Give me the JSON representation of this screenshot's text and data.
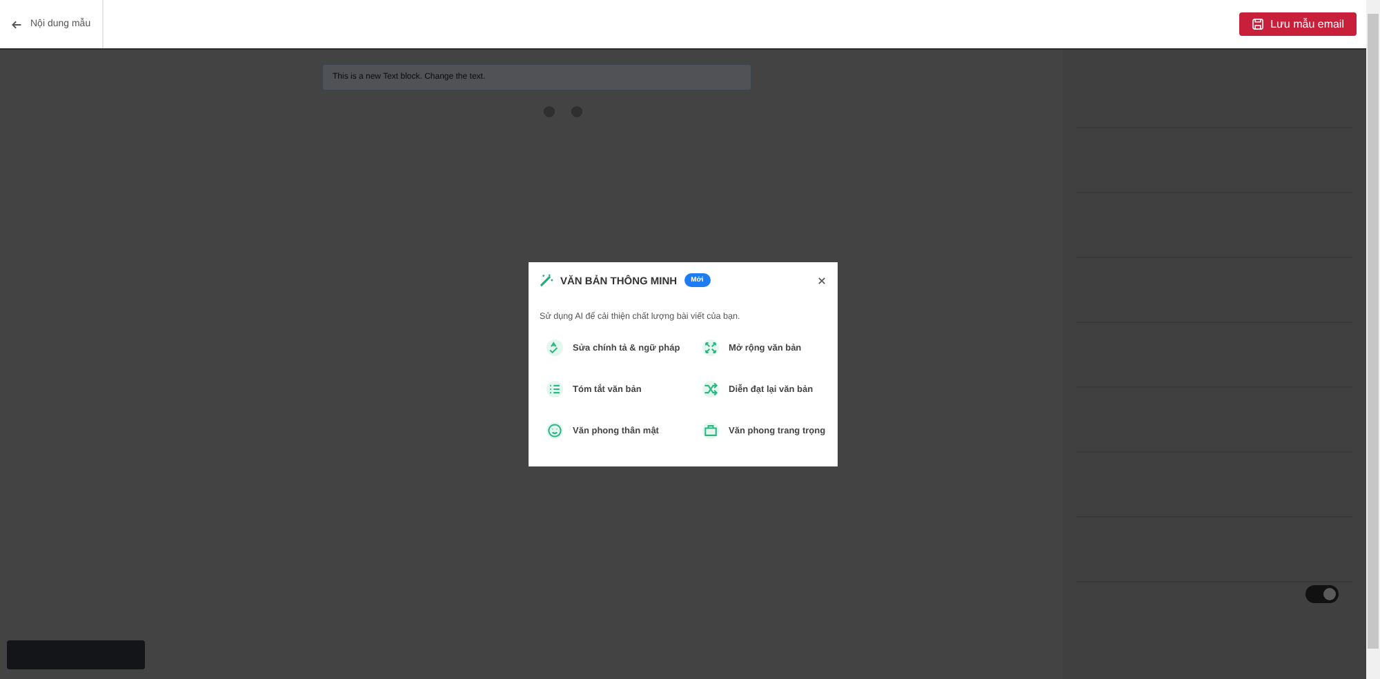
{
  "header": {
    "back_label": "Nội dung mẫu",
    "save_button": "Lưu mẫu email"
  },
  "canvas": {
    "text_block": "This is a new Text block. Change the text."
  },
  "settings_panel": {
    "toggle": {
      "on": true
    }
  },
  "modal": {
    "title": "VĂN BẢN THÔNG MINH",
    "badge": "Mới",
    "description": "Sử dụng AI để cải thiện chất lượng bài viết của bạn.",
    "options": [
      {
        "label": "Sửa chính tả & ngữ pháp"
      },
      {
        "label": "Mở rộng văn bản"
      },
      {
        "label": "Tóm tắt văn bản"
      },
      {
        "label": "Diễn đạt lại văn bản"
      },
      {
        "label": "Văn phong thân mật"
      },
      {
        "label": "Văn phong trang trọng"
      }
    ]
  }
}
